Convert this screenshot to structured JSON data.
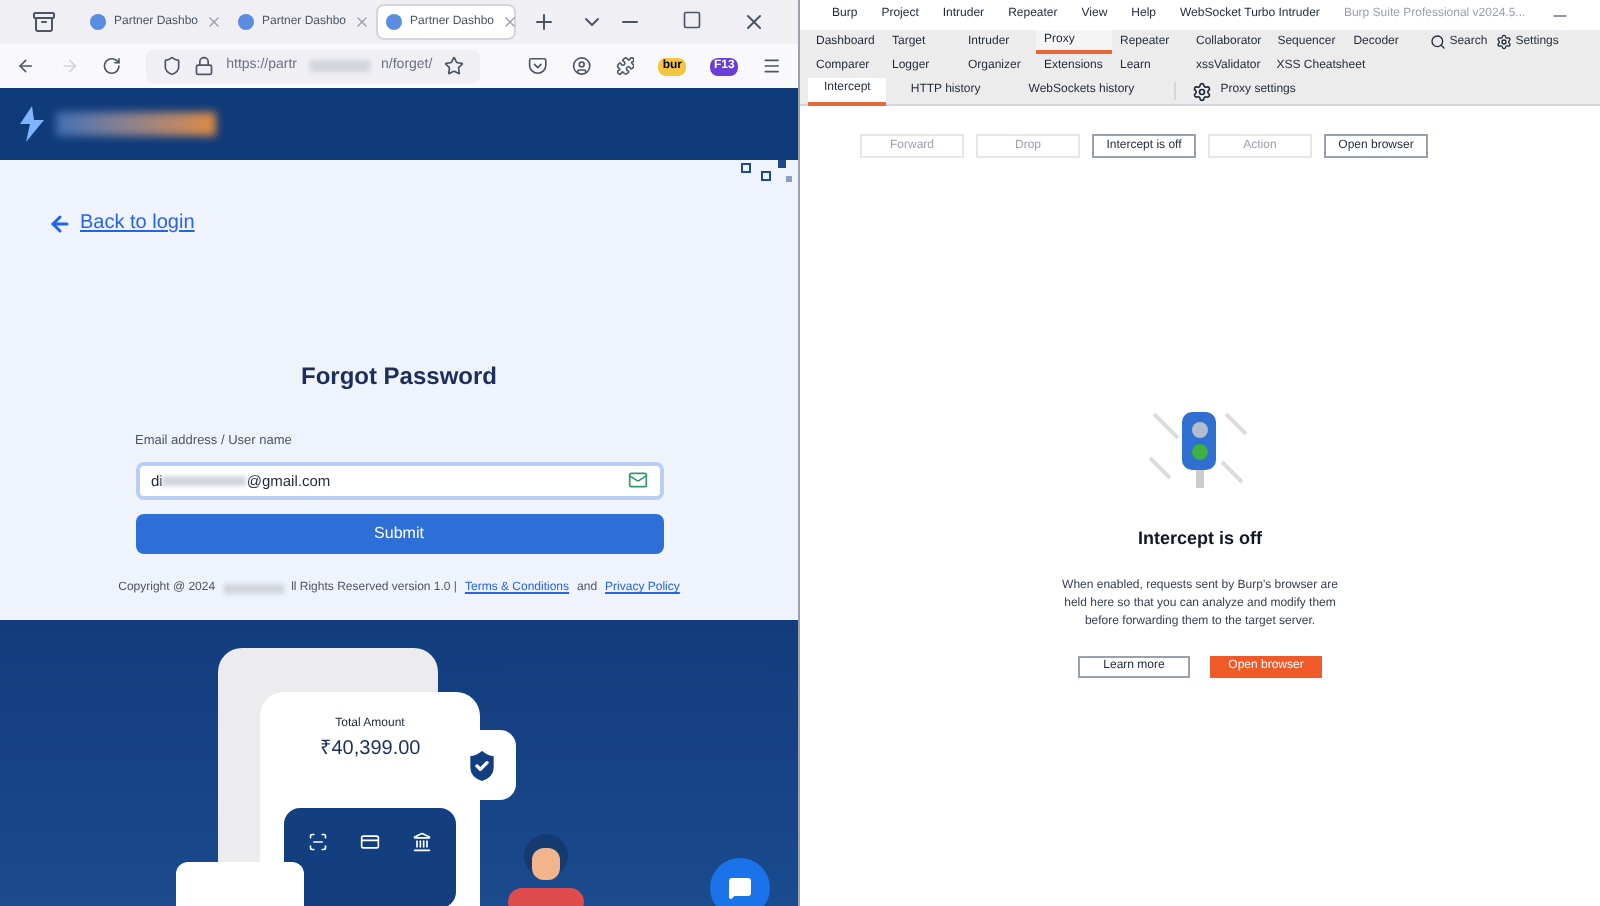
{
  "browser": {
    "tabs": [
      {
        "title": "Partner Dashbo",
        "selected": false
      },
      {
        "title": "Partner Dashbo",
        "selected": false
      },
      {
        "title": "Partner Dashbo",
        "selected": true
      }
    ],
    "url_start": "https://partr",
    "url_end": "n/forget/",
    "extension_badges": [
      "bur",
      "F13"
    ]
  },
  "site": {
    "back_link": "Back to login",
    "heading": "Forgot Password",
    "field_label": "Email address / User name",
    "email_start": "di",
    "email_end": "@gmail.com",
    "submit": "Submit",
    "footer": {
      "copyright": "Copyright @ 2024",
      "rights": "ll Rights Reserved version 1.0 |",
      "terms": "Terms & Conditions",
      "and": "and",
      "privacy": "Privacy Policy"
    },
    "illustration": {
      "total_label": "Total Amount",
      "amount": "₹40,399.00"
    }
  },
  "burp": {
    "menu": [
      "Burp",
      "Project",
      "Intruder",
      "Repeater",
      "View",
      "Help",
      "WebSocket Turbo Intruder"
    ],
    "window_title": "Burp Suite Professional v2024.5...",
    "tabs_row_1": [
      {
        "label": "Dashboard",
        "selected": false
      },
      {
        "label": "Target",
        "selected": false
      },
      {
        "label": "Intruder",
        "selected": false
      },
      {
        "label": "Proxy",
        "selected": true
      },
      {
        "label": "Repeater",
        "selected": false
      },
      {
        "label": "Collaborator",
        "selected": false
      },
      {
        "label": "Sequencer",
        "selected": false
      },
      {
        "label": "Decoder",
        "selected": false
      }
    ],
    "search": "Search",
    "settings": "Settings",
    "tabs_row_2": [
      {
        "label": "Comparer",
        "selected": false
      },
      {
        "label": "Logger",
        "selected": false
      },
      {
        "label": "Organizer",
        "selected": false
      },
      {
        "label": "Extensions",
        "selected": false
      },
      {
        "label": "Learn",
        "selected": false
      },
      {
        "label": "xssValidator",
        "selected": false
      },
      {
        "label": "XSS Cheatsheet",
        "selected": false
      }
    ],
    "subtabs": [
      {
        "label": "Intercept",
        "selected": true
      },
      {
        "label": "HTTP history",
        "selected": false
      },
      {
        "label": "WebSockets history",
        "selected": false
      }
    ],
    "proxy_settings": "Proxy settings",
    "actions": [
      {
        "label": "Forward",
        "disabled": true
      },
      {
        "label": "Drop",
        "disabled": true
      },
      {
        "label": "Intercept is off",
        "disabled": false
      },
      {
        "label": "Action",
        "disabled": true
      },
      {
        "label": "Open browser",
        "disabled": false
      }
    ],
    "empty_title": "Intercept is off",
    "empty_text": "When enabled, requests sent by Burp's browser are held here so that you can analyze and modify them before forwarding them to the target server.",
    "learn_more": "Learn more",
    "open_browser": "Open browser"
  }
}
